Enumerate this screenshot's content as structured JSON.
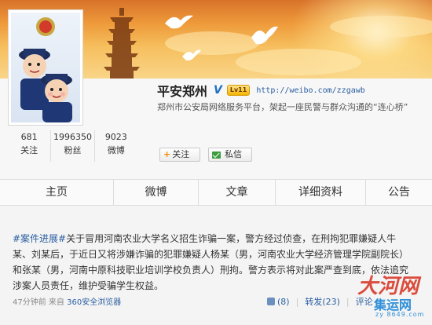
{
  "profile": {
    "name": "平安郑州",
    "verified": "V",
    "level": "Lv11",
    "url": "http://weibo.com/zzgawb",
    "description": "郑州市公安局网络服务平台，架起一座民警与群众沟通的“连心桥”"
  },
  "stats": [
    {
      "num": "681",
      "label": "关注"
    },
    {
      "num": "1996350",
      "label": "粉丝"
    },
    {
      "num": "9023",
      "label": "微博"
    }
  ],
  "buttons": {
    "follow": "关注",
    "follow_plus": "+",
    "message": "私信"
  },
  "nav": [
    "主页",
    "微博",
    "文章",
    "详细资料",
    "公告"
  ],
  "post": {
    "tag": "#案件进展#",
    "text": "关于冒用河南农业大学名义招生诈骗一案，警方经过侦查，在刑拘犯罪嫌疑人牛某、刘某后，于近日又将涉嫌诈骗的犯罪嫌疑人杨某（男，河南农业大学经济管理学院副院长）和张某（男，河南中原科技职业培训学校负责人）刑拘。警方表示将对此案严查到底，依法追究涉案人员责任，维护受骗学生权益。",
    "time": "47分钟前",
    "source_prefix": "来自",
    "source": "360安全浏览器",
    "likes": "(8)",
    "repost": "转发",
    "repost_count": "(23)",
    "comment": "评论"
  },
  "watermark": {
    "top": "大河网",
    "mid": "集运网",
    "bottom": "zy 8649.com"
  }
}
